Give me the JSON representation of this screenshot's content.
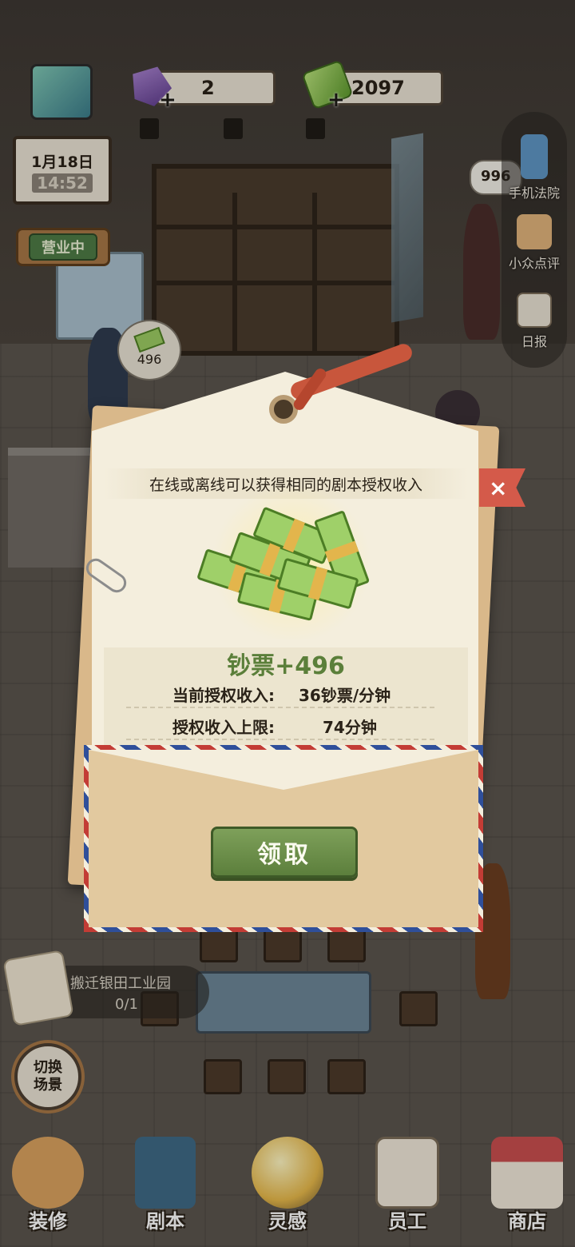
{
  "resources": {
    "gem_count": "2",
    "cash_count": "2097",
    "plus": "+"
  },
  "calendar": {
    "date": "1月18日",
    "time": "14:52"
  },
  "status_sign": "营业中",
  "side_menu": {
    "phone_bubble": "996",
    "phone_label": "手机法院",
    "review_label": "小众点评",
    "daily_label": "日报"
  },
  "customer_bubble": "496",
  "modal": {
    "subtitle": "在线或离线可以获得相同的剧本授权收入",
    "close_label": "×",
    "reward": "钞票+496",
    "rows": [
      {
        "key": "当前授权收入:",
        "value": "36钞票/分钟"
      },
      {
        "key": "授权收入上限:",
        "value": "74分钟"
      }
    ],
    "claim_label": "领取"
  },
  "task": {
    "title": "搬迁银田工业园",
    "progress": "0/1"
  },
  "switch_scene": {
    "line1": "切换",
    "line2": "场景"
  },
  "bottom_nav": [
    {
      "label": "装修",
      "icon": "house-icon"
    },
    {
      "label": "剧本",
      "icon": "script-book-icon"
    },
    {
      "label": "灵感",
      "icon": "lightbulb-icon"
    },
    {
      "label": "员工",
      "icon": "staff-card-icon"
    },
    {
      "label": "商店",
      "icon": "shop-icon"
    }
  ]
}
